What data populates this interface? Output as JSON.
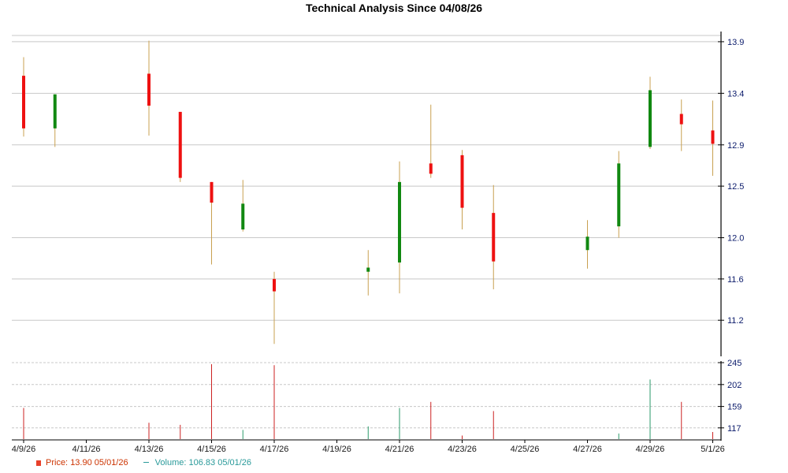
{
  "chart_data": {
    "type": "candlestick",
    "title": "Technical Analysis Since 04/08/26",
    "price_axis": {
      "ylim": [
        10.85,
        13.93
      ],
      "ticks": [
        "13.9",
        "13.4",
        "12.9",
        "12.5",
        "12.0",
        "11.6",
        "11.2"
      ]
    },
    "volume_axis": {
      "ylim": [
        95,
        245
      ],
      "ticks": [
        "245",
        "202",
        "159",
        "117"
      ]
    },
    "x_labels": [
      "4/9/26",
      "4/11/26",
      "4/13/26",
      "4/15/26",
      "4/17/26",
      "4/19/26",
      "4/21/26",
      "4/23/26",
      "4/25/26",
      "4/27/26",
      "4/29/26",
      "5/1/26"
    ],
    "candles": [
      {
        "date": "4/9/26",
        "open": 13.57,
        "close": 13.06,
        "high": 13.75,
        "low": 12.98,
        "volume": 156
      },
      {
        "date": "4/10/26",
        "open": 13.06,
        "close": 13.39,
        "high": 13.39,
        "low": 12.88,
        "volume": null
      },
      {
        "date": "4/13/26",
        "open": 13.59,
        "close": 13.28,
        "high": 13.91,
        "low": 12.99,
        "volume": 127
      },
      {
        "date": "4/14/26",
        "open": 13.22,
        "close": 12.58,
        "high": 13.22,
        "low": 12.54,
        "volume": 123
      },
      {
        "date": "4/15/26",
        "open": 12.54,
        "close": 12.34,
        "high": 12.54,
        "low": 11.74,
        "volume": 242
      },
      {
        "date": "4/16/26",
        "open": 12.08,
        "close": 12.33,
        "high": 12.56,
        "low": 12.06,
        "volume": 113
      },
      {
        "date": "4/17/26",
        "open": 11.6,
        "close": 11.48,
        "high": 11.67,
        "low": 10.97,
        "volume": 240
      },
      {
        "date": "4/20/26",
        "open": 11.67,
        "close": 11.71,
        "high": 11.88,
        "low": 11.44,
        "volume": 120
      },
      {
        "date": "4/21/26",
        "open": 11.76,
        "close": 12.54,
        "high": 12.74,
        "low": 11.46,
        "volume": 156
      },
      {
        "date": "4/22/26",
        "open": 12.72,
        "close": 12.62,
        "high": 13.29,
        "low": 12.58,
        "volume": 168
      },
      {
        "date": "4/23/26",
        "open": 12.8,
        "close": 12.29,
        "high": 12.85,
        "low": 12.08,
        "volume": 102
      },
      {
        "date": "4/24/26",
        "open": 12.24,
        "close": 11.77,
        "high": 12.51,
        "low": 11.5,
        "volume": 150
      },
      {
        "date": "4/27/26",
        "open": 11.88,
        "close": 12.01,
        "high": 12.17,
        "low": 11.7,
        "volume": null
      },
      {
        "date": "4/28/26",
        "open": 12.11,
        "close": 12.72,
        "high": 12.84,
        "low": 12.0,
        "volume": 106
      },
      {
        "date": "4/29/26",
        "open": 12.88,
        "close": 13.43,
        "high": 13.56,
        "low": 12.86,
        "volume": 212
      },
      {
        "date": "4/30/26",
        "open": 13.2,
        "close": 13.1,
        "high": 13.34,
        "low": 12.84,
        "volume": 168
      },
      {
        "date": "5/1/26",
        "open": 13.04,
        "close": 12.91,
        "high": 13.33,
        "low": 12.6,
        "volume": 109
      }
    ],
    "colors": {
      "up": "#118811",
      "down": "#ee1111",
      "wick": "#c8a050",
      "volume_up": "#2a9a6a",
      "volume_down": "#cc2222",
      "grid": "#c8c8c8"
    },
    "grid": true,
    "legend": {
      "price_label": "Price:",
      "price_value": "13.90",
      "price_date": "05/01/26",
      "volume_label": "Volume:",
      "volume_value": "106.83",
      "volume_date": "05/01/26"
    }
  }
}
